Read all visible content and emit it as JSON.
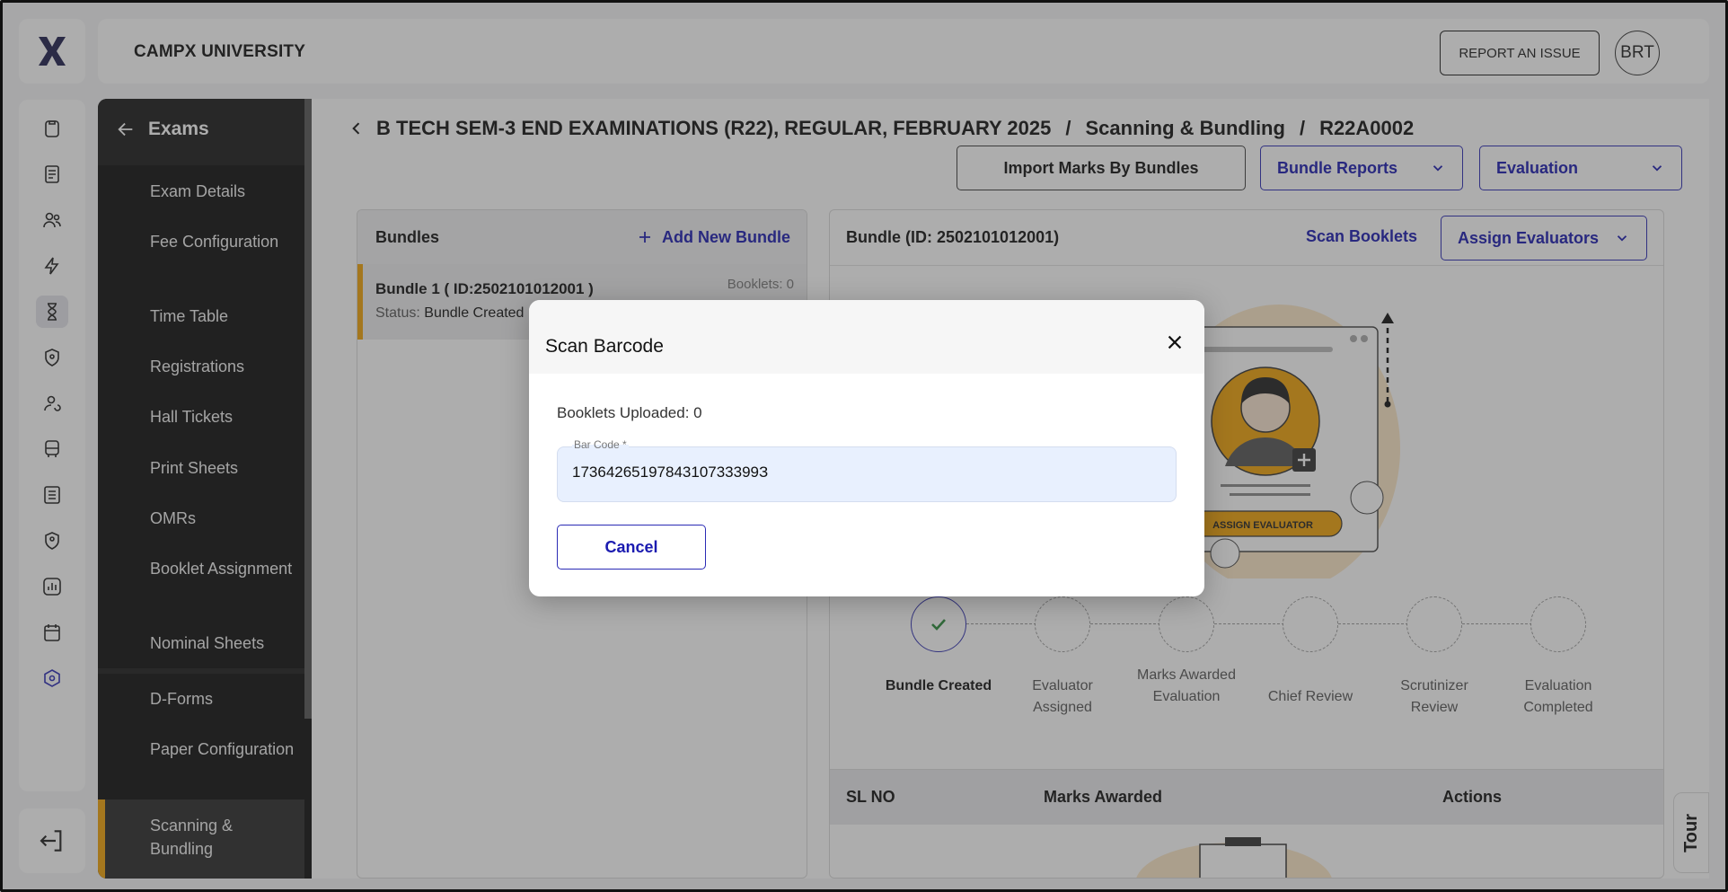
{
  "header": {
    "brand": "CAMPX UNIVERSITY",
    "report_label": "REPORT AN ISSUE",
    "avatar_initials": "BRT"
  },
  "sidenav": {
    "back_label": "Exams",
    "items": [
      "Exam Details",
      "Fee Configuration",
      "Time Table",
      "Registrations",
      "Hall Tickets",
      "Print Sheets",
      "OMRs",
      "Booklet Assignment",
      "Nominal Sheets",
      "D-Forms",
      "Paper Configuration",
      "Scanning & Bundling"
    ],
    "active_item": "Scanning & Bundling"
  },
  "breadcrumb": {
    "exam": "B TECH SEM-3 END EXAMINATIONS (R22), REGULAR, FEBRUARY 2025",
    "section": "Scanning & Bundling",
    "subject": "R22A0002",
    "separator": "/"
  },
  "actions": {
    "import_label": "Import Marks By Bundles",
    "bundle_reports_label": "Bundle Reports",
    "evaluation_label": "Evaluation"
  },
  "bundles_panel": {
    "title": "Bundles",
    "add_label": "Add New Bundle",
    "items": [
      {
        "name": "Bundle 1 ( ID:2502101012001 )",
        "status_prefix": "Status:",
        "status": "Bundle Created",
        "booklets": "Booklets: 0"
      }
    ]
  },
  "detail_panel": {
    "title": "Bundle (ID: 2502101012001)",
    "scan_label": "Scan Booklets",
    "assign_label": "Assign Evaluators",
    "illustration_caption": "ASSIGN EVALUATOR",
    "steps": [
      "Bundle Created",
      "Evaluator Assigned",
      "Marks Awarded Evaluation",
      "Chief Review",
      "Scrutinizer Review",
      "Evaluation Completed"
    ],
    "completed_steps": 1,
    "table_headers": [
      "SL NO",
      "Marks Awarded",
      "Actions"
    ]
  },
  "tour_label": "Tour",
  "modal": {
    "title": "Scan Barcode",
    "uploaded_text": "Booklets Uploaded: 0",
    "field_label": "Bar Code *",
    "field_value": "1736426519784310733399З",
    "cancel_label": "Cancel"
  },
  "colors": {
    "accent": "#1b1bb0",
    "active_marker": "#f0a30a",
    "sidenav_bg": "#0e0e0e"
  }
}
